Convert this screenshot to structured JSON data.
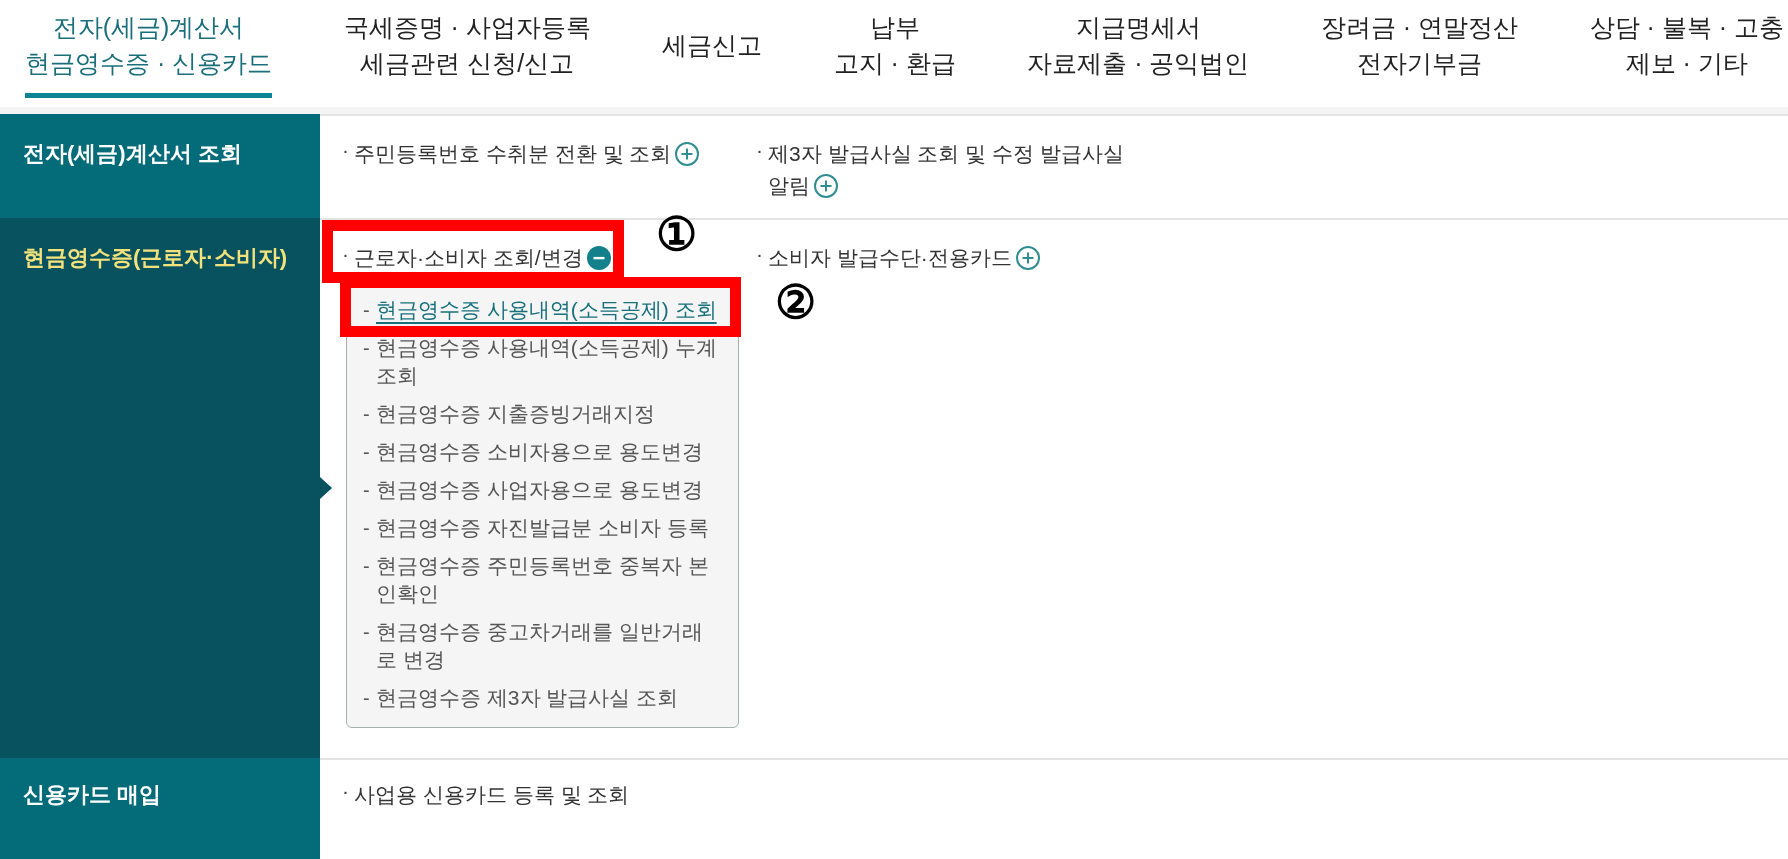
{
  "nav_tabs": [
    {
      "lines": [
        "전자(세금)계산서",
        "현금영수증 · 신용카드"
      ],
      "selected": true
    },
    {
      "lines": [
        "국세증명 · 사업자등록",
        "세금관련 신청/신고"
      ],
      "selected": false
    },
    {
      "lines": [
        "세금신고"
      ],
      "selected": false
    },
    {
      "lines": [
        "납부",
        "고지 · 환급"
      ],
      "selected": false
    },
    {
      "lines": [
        "지급명세서",
        "자료제출 · 공익법인"
      ],
      "selected": false
    },
    {
      "lines": [
        "장려금 · 연말정산",
        "전자기부금"
      ],
      "selected": false
    },
    {
      "lines": [
        "상담 · 불복 · 고충",
        "제보 · 기타"
      ],
      "selected": false
    }
  ],
  "categories": [
    {
      "label": "전자(세금)계산서 조회",
      "selected": false,
      "items": [
        {
          "bullet": "·",
          "label": "주민등록번호 수취분 전환 및 조회",
          "kind": "toggle",
          "expanded": false
        },
        {
          "bullet": "·",
          "label": "제3자 발급사실 조회 및 수정 발급사실 알림",
          "kind": "toggle",
          "expanded": false
        }
      ]
    },
    {
      "label": "현금영수증(근로자·소비자)",
      "selected": true,
      "items": [
        {
          "bullet": "·",
          "label": "근로자·소비자 조회/변경",
          "kind": "toggle",
          "expanded": true,
          "callout": "①",
          "children": [
            {
              "bullet": "-",
              "label": "현금영수증 사용내역(소득공제) 조회",
              "selected": true,
              "callout": "②"
            },
            {
              "bullet": "-",
              "label": "현금영수증 사용내역(소득공제) 누계 조회",
              "selected": false
            },
            {
              "bullet": "-",
              "label": "현금영수증 지출증빙거래지정",
              "selected": false
            },
            {
              "bullet": "-",
              "label": "현금영수증 소비자용으로 용도변경",
              "selected": false
            },
            {
              "bullet": "-",
              "label": "현금영수증 사업자용으로 용도변경",
              "selected": false
            },
            {
              "bullet": "-",
              "label": "현금영수증 자진발급분 소비자 등록",
              "selected": false
            },
            {
              "bullet": "-",
              "label": "현금영수증 주민등록번호 중복자 본인확인",
              "selected": false
            },
            {
              "bullet": "-",
              "label": "현금영수증 중고차거래를 일반거래로 변경",
              "selected": false
            },
            {
              "bullet": "-",
              "label": "현금영수증 제3자 발급사실 조회",
              "selected": false
            }
          ]
        },
        {
          "bullet": "·",
          "label": "소비자 발급수단·전용카드",
          "kind": "toggle",
          "expanded": false
        }
      ]
    },
    {
      "label": "신용카드 매입",
      "selected": false,
      "items": [
        {
          "bullet": "·",
          "label": "사업용 신용카드 등록 및 조회",
          "kind": "plain"
        }
      ]
    }
  ]
}
